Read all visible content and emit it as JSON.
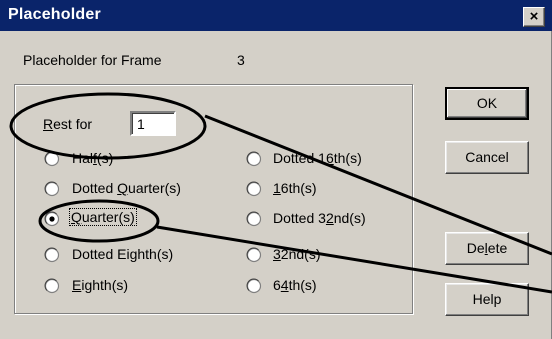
{
  "window": {
    "title": "Placeholder",
    "close_label": "×"
  },
  "frame_info": {
    "label": "Placeholder for Frame",
    "value": "3"
  },
  "rest_for": {
    "label_first": "R",
    "label_rest": "est for",
    "value": "1"
  },
  "options": [
    {
      "pre": "Hal",
      "key": "f",
      "post": "(s)",
      "selected": false
    },
    {
      "pre": "Dotted ",
      "key": "Q",
      "post": "uarter(s)",
      "selected": false
    },
    {
      "pre": "",
      "key": "Q",
      "post": "uarter(s)",
      "selected": true
    },
    {
      "pre": "Dotted Eighth(s)",
      "key": "",
      "post": "",
      "selected": false
    },
    {
      "pre": "",
      "key": "E",
      "post": "ighth(s)",
      "selected": false
    },
    {
      "pre": "Dotted 1",
      "key": "6",
      "post": "th(s)",
      "selected": false
    },
    {
      "pre": "",
      "key": "1",
      "post": "6th(s)",
      "selected": false
    },
    {
      "pre": "Dotted 3",
      "key": "2",
      "post": "nd(s)",
      "selected": false
    },
    {
      "pre": "",
      "key": "3",
      "post": "2nd(s)",
      "selected": false
    },
    {
      "pre": "6",
      "key": "4",
      "post": "th(s)",
      "selected": false
    }
  ],
  "buttons": {
    "ok": "OK",
    "cancel": "Cancel",
    "delete_pre": "De",
    "delete_key": "l",
    "delete_post": "ete",
    "help": "Help"
  },
  "colors": {
    "titlebar": "#0a246a",
    "dialog_bg": "#d4d0c8",
    "annotation": "#000000"
  }
}
